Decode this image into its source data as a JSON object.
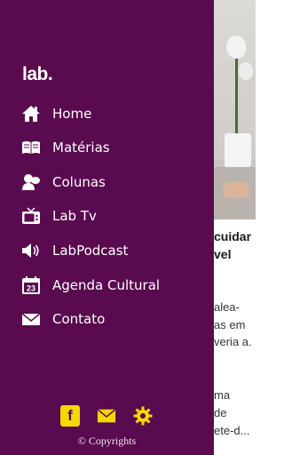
{
  "drawer": {
    "logo": "lab.",
    "menu": [
      {
        "label": "Home",
        "icon": "home-icon"
      },
      {
        "label": "Matérias",
        "icon": "book-icon"
      },
      {
        "label": "Colunas",
        "icon": "people-icon"
      },
      {
        "label": "Lab Tv",
        "icon": "tv-icon"
      },
      {
        "label": "LabPodcast",
        "icon": "speaker-icon"
      },
      {
        "label": "Agenda Cultural",
        "icon": "calendar-icon"
      },
      {
        "label": "Contato",
        "icon": "envelope-icon"
      }
    ],
    "calendar_day": "23",
    "social": {
      "facebook_glyph": "f",
      "icons": [
        "facebook-icon",
        "mail-icon",
        "settings-gear-icon"
      ],
      "accent_color": "#f5d800"
    },
    "copyright": "© Copyrights",
    "background_color": "#5a0a4e"
  },
  "background_article": {
    "headline_line1": "cuidar",
    "headline_line2": "vel",
    "body_lines": [
      "alea-",
      "as em",
      "veria a.",
      "ma",
      "de",
      "ete-d..."
    ]
  }
}
